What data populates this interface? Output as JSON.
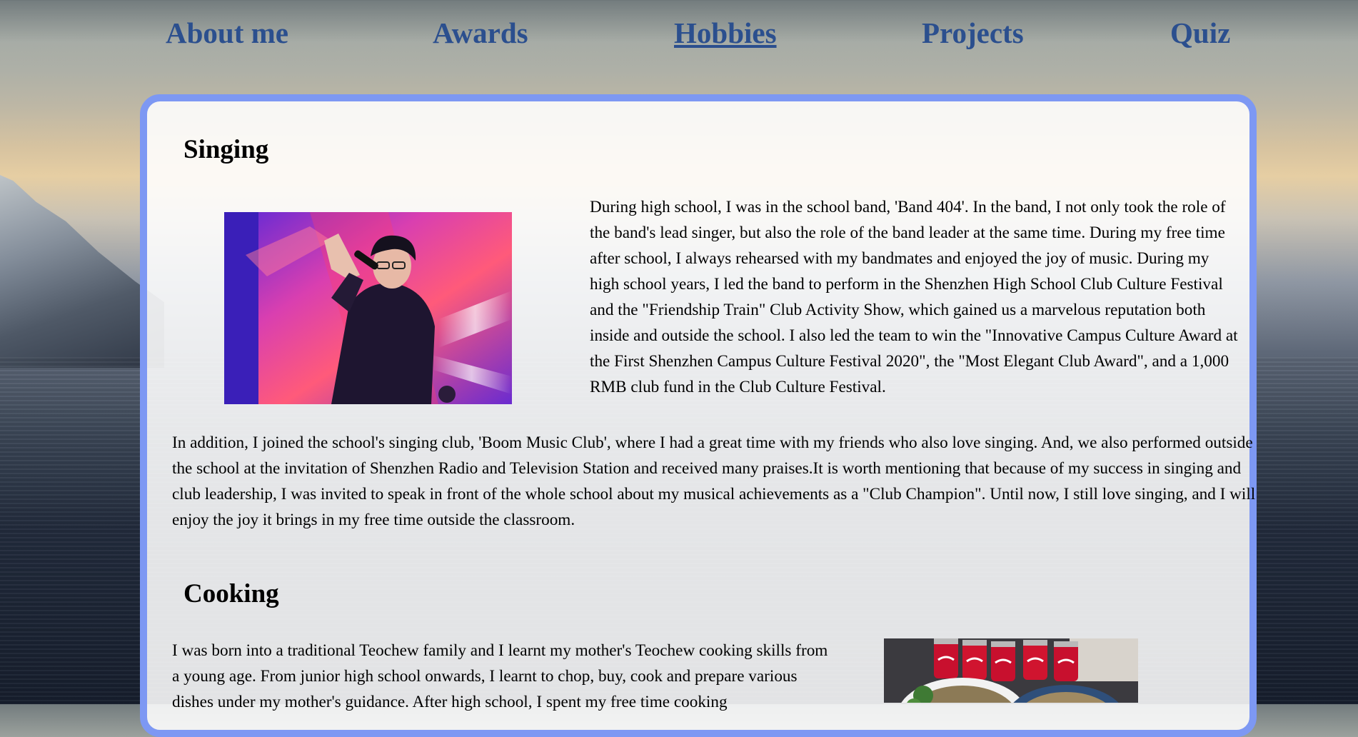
{
  "nav": {
    "items": [
      {
        "label": "About me"
      },
      {
        "label": "Awards"
      },
      {
        "label": "Hobbies"
      },
      {
        "label": "Projects"
      },
      {
        "label": "Quiz"
      }
    ],
    "active": "Hobbies"
  },
  "colors": {
    "nav_link": "#2b4f8e",
    "card_border": "#7d98f3"
  },
  "sections": {
    "singing": {
      "title": "Singing",
      "para1": "During high school, I was in the school band, 'Band 404'. In the band, I not only took the role of the band's lead singer, but also the role of the band leader at the same time. During my free time after school, I always rehearsed with my bandmates and enjoyed the joy of music. During my high school years, I led the band to perform in the Shenzhen High School Club Culture Festival and the \"Friendship Train\" Club Activity Show, which gained us a marvelous reputation both inside and outside the school. I also led the team to win the \"Innovative Campus Culture Award at the First Shenzhen Campus Culture Festival 2020\", the \"Most Elegant Club Award\", and a 1,000 RMB club fund in the Club Culture Festival.",
      "para2": "In addition, I joined the school's singing club, 'Boom Music Club', where I had a great time with my friends who also love singing. And, we also performed outside the school at the invitation of Shenzhen Radio and Television Station and received many praises.It is worth mentioning that because of my success in singing and club leadership, I was invited to speak in front of the whole school about my musical achievements as a \"Club Champion\". Until now, I still love singing, and I will enjoy the joy it brings in my free time outside the classroom."
    },
    "cooking": {
      "title": "Cooking",
      "para1": "I was born into a traditional Teochew family and I learnt my mother's Teochew cooking skills from a young age. From junior high school onwards, I learnt to chop, buy, cook and prepare various dishes under my mother's guidance. After high school, I spent my free time cooking"
    }
  }
}
